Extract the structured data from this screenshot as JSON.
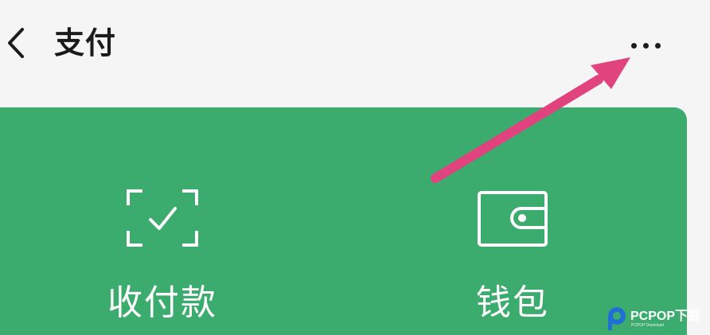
{
  "header": {
    "title": "支付",
    "back_icon": "chevron-left-icon",
    "more_icon": "more-dots-icon"
  },
  "pay_card": {
    "background": "#3cac6e",
    "actions": [
      {
        "label": "收付款",
        "icon": "scan-check-icon"
      },
      {
        "label": "钱包",
        "icon": "wallet-icon"
      }
    ]
  },
  "annotation": {
    "arrow_color": "#e0437d"
  },
  "watermark": {
    "brand": "PCPOP下载",
    "subtext": "PCPOP Download"
  }
}
